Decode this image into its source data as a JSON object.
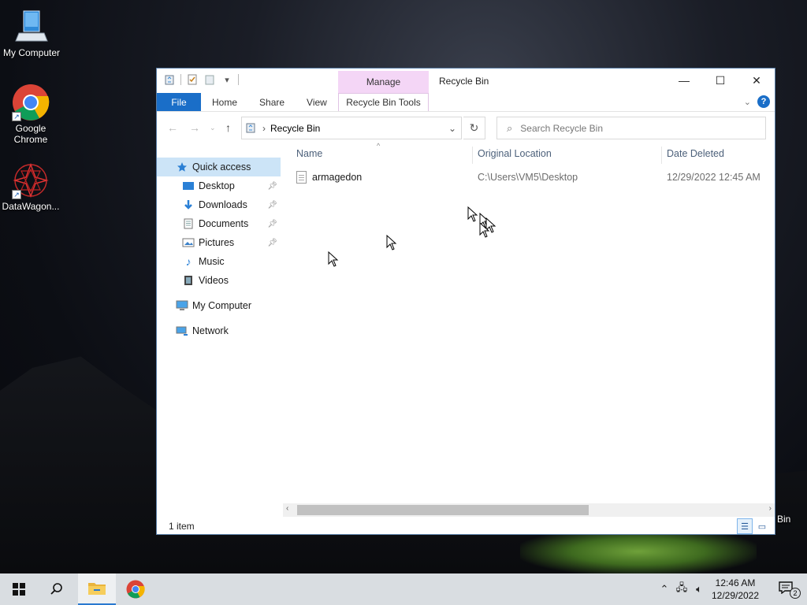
{
  "desktop": {
    "icons": [
      {
        "label": "My Computer"
      },
      {
        "label": "Google Chrome"
      },
      {
        "label": "DataWagon..."
      }
    ],
    "recycle_label_partial": "Bin"
  },
  "window": {
    "title": "Recycle Bin",
    "contextual_tab_group": "Manage",
    "ribbon_tabs": [
      "File",
      "Home",
      "Share",
      "View",
      "Recycle Bin Tools"
    ],
    "address": {
      "crumbs": [
        "Recycle Bin"
      ]
    },
    "search": {
      "placeholder": "Search Recycle Bin"
    },
    "sidebar": {
      "items": [
        {
          "label": "Quick access",
          "icon": "star-icon",
          "selected": true
        },
        {
          "label": "Desktop",
          "icon": "desktop-icon",
          "pinned": true
        },
        {
          "label": "Downloads",
          "icon": "download-icon",
          "pinned": true
        },
        {
          "label": "Documents",
          "icon": "document-icon",
          "pinned": true
        },
        {
          "label": "Pictures",
          "icon": "picture-icon",
          "pinned": true
        },
        {
          "label": "Music",
          "icon": "music-icon"
        },
        {
          "label": "Videos",
          "icon": "video-icon"
        },
        {
          "label": "My Computer",
          "icon": "computer-icon"
        },
        {
          "label": "Network",
          "icon": "network-icon"
        }
      ]
    },
    "columns": [
      "Name",
      "Original Location",
      "Date Deleted"
    ],
    "rows": [
      {
        "name": "armagedon",
        "location": "C:\\Users\\VM5\\Desktop",
        "date": "12/29/2022 12:45 AM"
      }
    ],
    "status": "1 item"
  },
  "taskbar": {
    "clock": {
      "time": "12:46 AM",
      "date": "12/29/2022"
    },
    "notification_count": "2"
  },
  "colors": {
    "accent": "#1a6ec8",
    "manage_tab": "#f4d6f6",
    "selected_nav": "#cce4f7"
  }
}
